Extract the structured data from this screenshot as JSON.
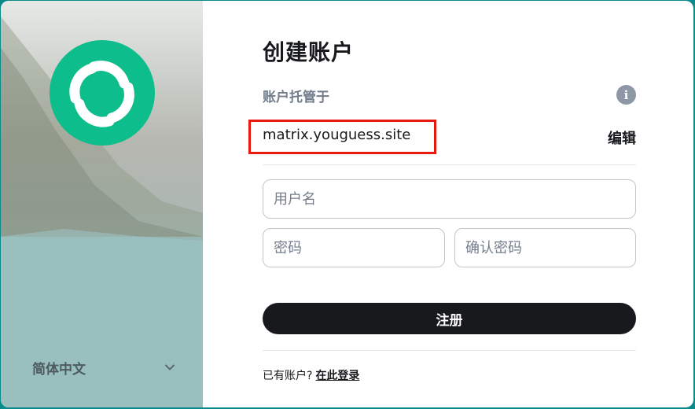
{
  "colors": {
    "accent": "#0dbd8b",
    "primary_button": "#17191c",
    "highlight_border": "#e8190f",
    "muted_text": "#737d8c"
  },
  "sidebar": {
    "logo_icon": "element-logo-icon",
    "language": {
      "label": "简体中文",
      "icon": "chevron-down-icon"
    }
  },
  "form": {
    "title": "创建账户",
    "hosted_label": "账户托管于",
    "info_icon": "info-icon",
    "info_symbol": "i",
    "server_name": "matrix.youguess.site",
    "edit_label": "编辑",
    "username": {
      "placeholder": "用户名",
      "value": ""
    },
    "password": {
      "placeholder": "密码",
      "value": ""
    },
    "confirm_password": {
      "placeholder": "确认密码",
      "value": ""
    },
    "register_label": "注册",
    "have_account_text": "已有账户?",
    "login_link": "在此登录"
  }
}
